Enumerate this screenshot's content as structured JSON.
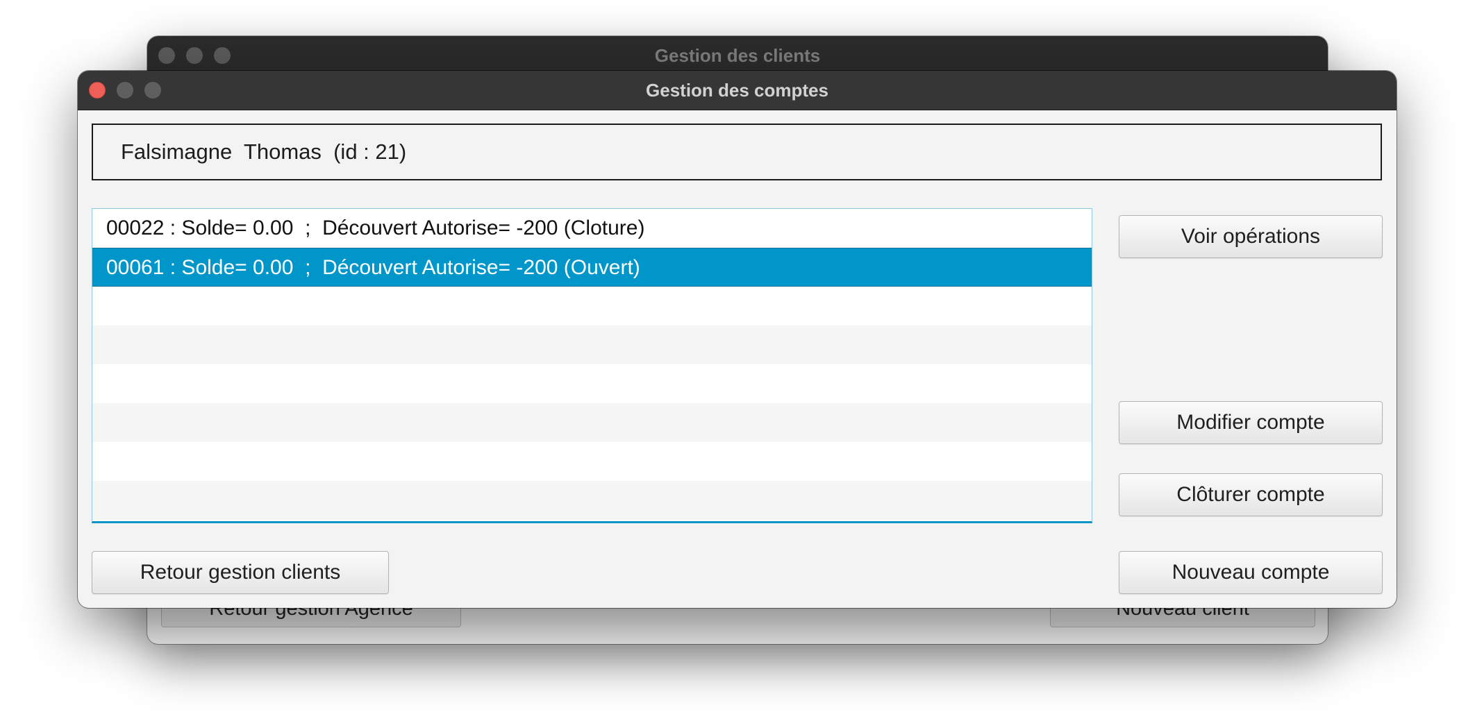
{
  "background_window": {
    "title": "Gestion des clients",
    "left_button": "Retour gestion Agence",
    "right_button": "Nouveau client"
  },
  "window": {
    "title": "Gestion des comptes"
  },
  "client": {
    "label": "Falsimagne  Thomas  (id : 21)"
  },
  "accounts": {
    "items": [
      {
        "label": "00022 : Solde= 0.00  ;  Découvert Autorise= -200 (Cloture)"
      },
      {
        "label": "00061 : Solde= 0.00  ;  Découvert Autorise= -200 (Ouvert)"
      }
    ],
    "selected_index": 1
  },
  "buttons": {
    "view_operations": "Voir opérations",
    "modify_account": "Modifier compte",
    "close_account": "Clôturer compte",
    "back_clients": "Retour gestion clients",
    "new_account": "Nouveau compte"
  },
  "colors": {
    "selection": "#0096c9",
    "close_dot": "#ed5f57",
    "titlebar": "#363636"
  }
}
